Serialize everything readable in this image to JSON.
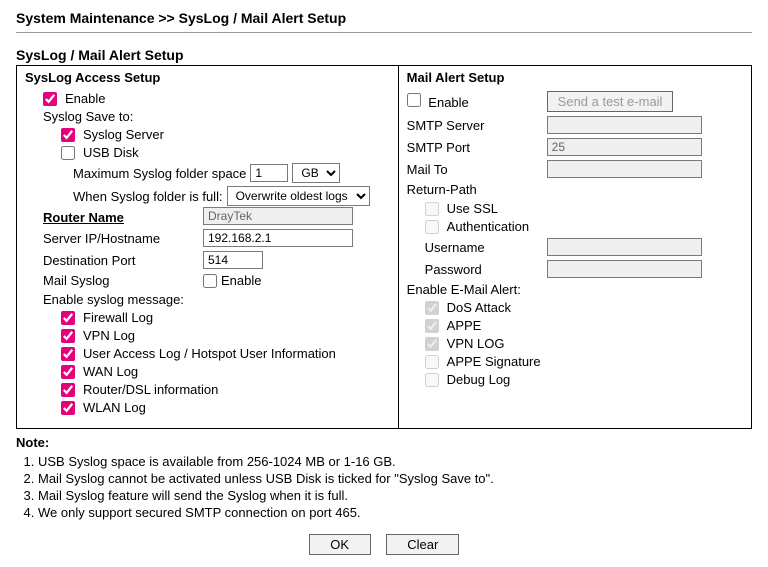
{
  "breadcrumb": "System Maintenance >> SysLog / Mail Alert Setup",
  "section_title": "SysLog / Mail Alert Setup",
  "left": {
    "header": "SysLog Access Setup",
    "enable_label": "Enable",
    "enable_checked": true,
    "save_to_label": "Syslog Save to:",
    "syslog_server_label": "Syslog Server",
    "syslog_server_checked": true,
    "usb_disk_label": "USB Disk",
    "usb_disk_checked": false,
    "max_folder_label": "Maximum Syslog folder space",
    "max_folder_value": "1",
    "max_folder_unit": "GB",
    "max_folder_unit_options": [
      "GB"
    ],
    "when_full_label": "When Syslog folder is full:",
    "when_full_value": "Overwrite oldest logs",
    "when_full_options": [
      "Overwrite oldest logs"
    ],
    "router_name_label": "Router Name",
    "router_name_value": "DrayTek",
    "server_ip_label": "Server IP/Hostname",
    "server_ip_value": "192.168.2.1",
    "dest_port_label": "Destination Port",
    "dest_port_value": "514",
    "mail_syslog_label": "Mail Syslog",
    "mail_syslog_enable_label": "Enable",
    "mail_syslog_enable_checked": false,
    "enable_msg_label": "Enable syslog message:",
    "logs": [
      {
        "label": "Firewall Log",
        "checked": true
      },
      {
        "label": "VPN Log",
        "checked": true
      },
      {
        "label": "User Access Log / Hotspot User Information",
        "checked": true
      },
      {
        "label": "WAN Log",
        "checked": true
      },
      {
        "label": "Router/DSL information",
        "checked": true
      },
      {
        "label": "WLAN Log",
        "checked": true
      }
    ]
  },
  "right": {
    "header": "Mail Alert Setup",
    "enable_label": "Enable",
    "enable_checked": false,
    "test_btn": "Send a test e-mail",
    "smtp_server_label": "SMTP Server",
    "smtp_server_value": "",
    "smtp_port_label": "SMTP Port",
    "smtp_port_value": "25",
    "mail_to_label": "Mail To",
    "mail_to_value": "",
    "return_path_label": "Return-Path",
    "use_ssl_label": "Use SSL",
    "use_ssl_checked": false,
    "auth_label": "Authentication",
    "auth_checked": false,
    "username_label": "Username",
    "username_value": "",
    "password_label": "Password",
    "password_value": "",
    "alert_heading": "Enable E-Mail Alert:",
    "alerts": [
      {
        "label": "DoS Attack",
        "checked": true,
        "disabled": true
      },
      {
        "label": "APPE",
        "checked": true,
        "disabled": true
      },
      {
        "label": "VPN LOG",
        "checked": true,
        "disabled": true
      },
      {
        "label": "APPE Signature",
        "checked": false,
        "disabled": true
      },
      {
        "label": "Debug Log",
        "checked": false,
        "disabled": true
      }
    ]
  },
  "note_head": "Note:",
  "notes": [
    "USB Syslog space is available from 256-1024 MB or 1-16 GB.",
    "Mail Syslog cannot be activated unless USB Disk is ticked for \"Syslog Save to\".",
    "Mail Syslog feature will send the Syslog when it is full.",
    "We only support secured SMTP connection on port 465."
  ],
  "buttons": {
    "ok": "OK",
    "clear": "Clear"
  }
}
